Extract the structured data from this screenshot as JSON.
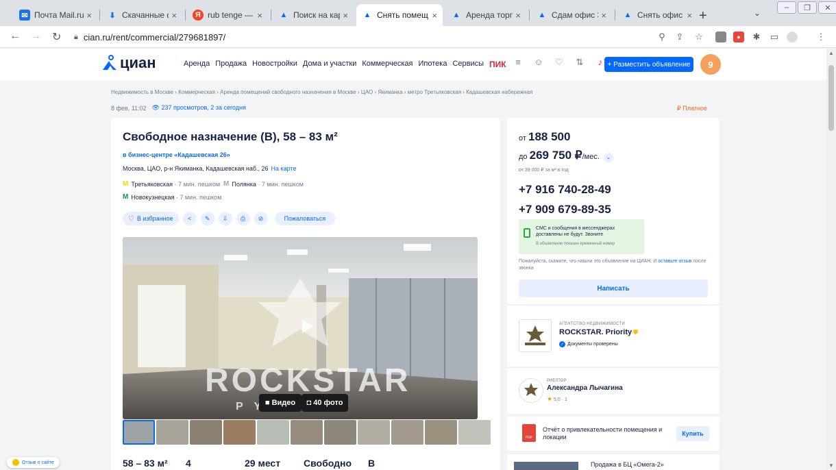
{
  "browser": {
    "tabs": [
      {
        "title": "Почта Mail.ru",
        "icon": "mail-icon",
        "active": false
      },
      {
        "title": "Скачанные фа",
        "icon": "download-icon",
        "active": false
      },
      {
        "title": "rub tenge — Я",
        "icon": "yandex-icon",
        "active": false
      },
      {
        "title": "Поиск на карт",
        "icon": "cian-icon",
        "active": false
      },
      {
        "title": "Снять помещ",
        "icon": "cian-icon",
        "active": true
      },
      {
        "title": "Аренда торго",
        "icon": "cian-icon",
        "active": false
      },
      {
        "title": "Сдам офис 37",
        "icon": "cian-icon",
        "active": false
      },
      {
        "title": "Снять офис 14",
        "icon": "cian-icon",
        "active": false
      }
    ],
    "close_glyph": "×",
    "new_tab": "+",
    "url": "cian.ru/rent/commercial/279681897/"
  },
  "site": {
    "logo_text": "циан",
    "nav": [
      "Аренда",
      "Продажа",
      "Новостройки",
      "Дома и участки",
      "Коммерческая",
      "Ипотека",
      "Сервисы"
    ],
    "pik": "ПИК",
    "post_button": "+ Разместить объявление",
    "avatar_letter": "9"
  },
  "breadcrumbs": "Недвижимость в Москве  ›  Коммерческая  ›  Аренда помещений свободного назначения в Москве  ›  ЦАО  ›  Якиманка  ›  метро Третьяковская  ›  Кадашевская набережная",
  "meta": {
    "date": "8 фев, 11:02",
    "views": "237 просмотров, 2 за сегодня",
    "paid": "Платное"
  },
  "listing": {
    "title": "Свободное назначение (B), 58 – 83 м²",
    "business_center": "в бизнес-центре «Кадашевская 26»",
    "address": "Москва, ЦАО, р-н Якиманка, Кадашевская наб., 26",
    "map_link": "На карте",
    "metro": [
      {
        "name": "Третьяковская",
        "dist": "· 7 мин. пешком",
        "color": "#ffd702"
      },
      {
        "name": "Полянка",
        "dist": "· 7 мин. пешком",
        "color": "#a2a5b4"
      },
      {
        "name": "Новокузнецкая",
        "dist": "· 7 мин. пешком",
        "color": "#029a55"
      }
    ],
    "favorite": "В избранное",
    "report": "Пожаловаться",
    "video_btn": "Видео",
    "photos_btn": "40 фото",
    "watermark": "ROCKSTAR",
    "watermark_sub": "P          Y",
    "stats": [
      "58 – 83 м²",
      "4",
      "29 мест",
      "Свободно",
      "B"
    ]
  },
  "price": {
    "from_prefix": "от",
    "from_value": "188 500",
    "to_prefix": "до",
    "to_value": "269 750 ₽",
    "to_suffix": "/мес.",
    "per_sqm": "от 39 000 ₽ за м² в год",
    "phones": [
      "+7 916 740-28-49",
      "+7 909 679-89-35"
    ],
    "notice_text": "СМС и сообщения в мессенджерах доставлены не будут. Звоните",
    "notice_sub": "В объявлении показан временный номер",
    "ask_pre": "Пожалуйста, скажите, что нашли это объявление на ЦИАН. И ",
    "ask_link": "оставьте отзыв",
    "ask_post": " после звонка",
    "write_button": "Написать"
  },
  "agency": {
    "label": "АГЕНТСТВО НЕДВИЖИМОСТИ",
    "name": "ROCKSTAR. Priority",
    "verified": "Документы проверены"
  },
  "realtor": {
    "label": "РИЕЛТОР",
    "name": "Александра Лычагина",
    "rating": "5,0 · 1"
  },
  "report_card": {
    "pdf_label": "PDF",
    "text": "Отчёт о привлекательности помещения и локации",
    "buy": "Купить"
  },
  "promo": {
    "text": "Продажа в БЦ «Омега-2»"
  },
  "feedback": "Отзыв о сайте"
}
